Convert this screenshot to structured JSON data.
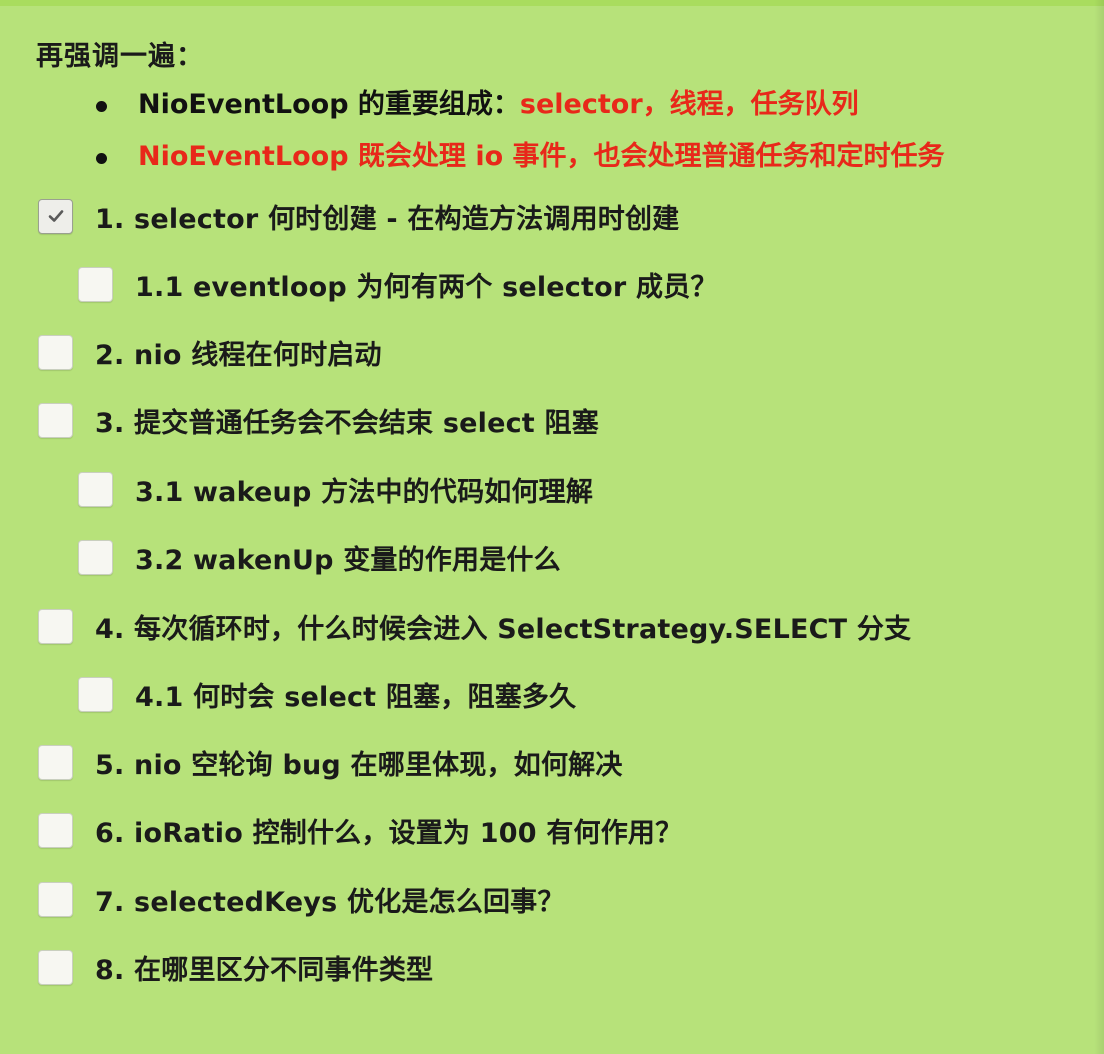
{
  "note": {
    "heading": "再强调一遍：",
    "bullets": [
      {
        "prefix": "NioEventLoop 的重要组成：",
        "highlight": "selector，线程，任务队列"
      },
      {
        "prefix": "",
        "highlight": "NioEventLoop 既会处理 io 事件，也会处理普通任务和定时任务"
      }
    ]
  },
  "tasks": [
    {
      "label": "1. selector 何时创建 - 在构造方法调用时创建",
      "checked": true,
      "level": 0
    },
    {
      "label": "1.1 eventloop 为何有两个 selector 成员？",
      "checked": false,
      "level": 1
    },
    {
      "label": "2. nio 线程在何时启动",
      "checked": false,
      "level": 0
    },
    {
      "label": "3. 提交普通任务会不会结束 select 阻塞",
      "checked": false,
      "level": 0
    },
    {
      "label": "3.1 wakeup 方法中的代码如何理解",
      "checked": false,
      "level": 1
    },
    {
      "label": "3.2 wakenUp 变量的作用是什么",
      "checked": false,
      "level": 1
    },
    {
      "label": "4. 每次循环时，什么时候会进入 SelectStrategy.SELECT 分支",
      "checked": false,
      "level": 0
    },
    {
      "label": "4.1 何时会 select 阻塞，阻塞多久",
      "checked": false,
      "level": 1
    },
    {
      "label": "5. nio 空轮询 bug 在哪里体现，如何解决",
      "checked": false,
      "level": 0
    },
    {
      "label": "6. ioRatio 控制什么，设置为 100 有何作用？",
      "checked": false,
      "level": 0
    },
    {
      "label": "7. selectedKeys 优化是怎么回事？",
      "checked": false,
      "level": 0
    },
    {
      "label": "8. 在哪里区分不同事件类型",
      "checked": false,
      "level": 0
    }
  ],
  "colors": {
    "background": "#b7e27a",
    "highlight": "#e8281a",
    "text": "#1a1a1a"
  },
  "icons": {
    "checked": "check-icon",
    "bullet": "bullet-dot"
  }
}
